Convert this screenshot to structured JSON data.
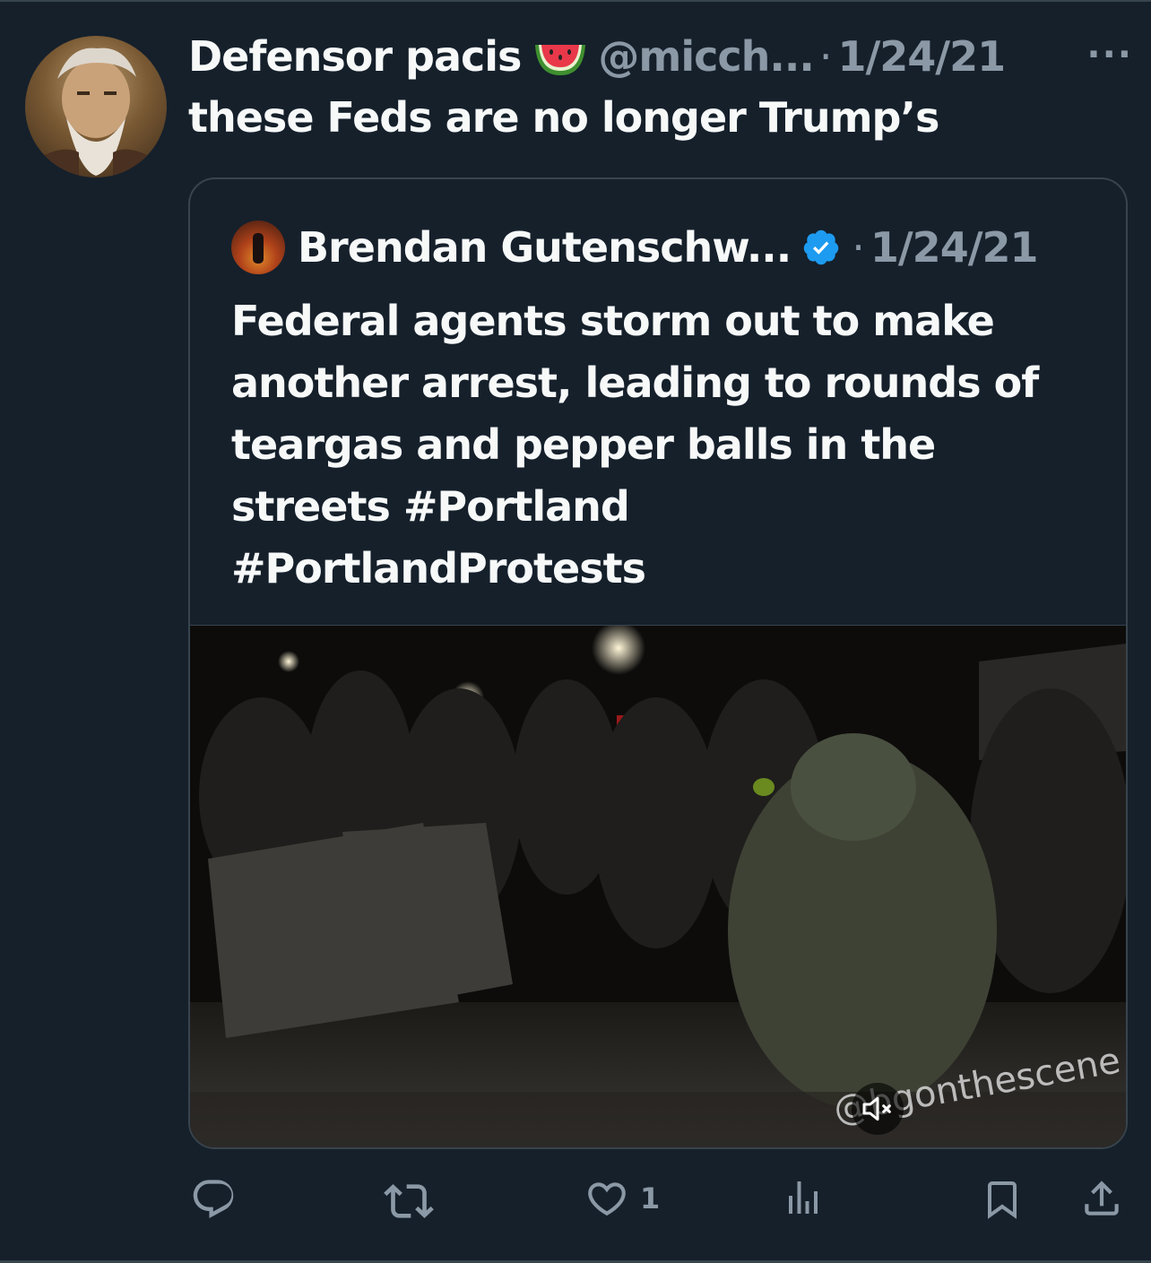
{
  "tweet": {
    "author_name": "Defensor pacis",
    "author_emoji": "watermelon-emoji",
    "handle": "@micch...",
    "separator": "·",
    "date": "1/24/21",
    "more": "···",
    "text": "these Feds are no longer Trump’s"
  },
  "quote": {
    "author_name": "Brendan Gutenschw...",
    "separator": "·",
    "date": "1/24/21",
    "text_lines": [
      "Federal agents storm out to make",
      "another arrest, leading to rounds of",
      "teargas and pepper balls in the",
      "streets #Portland",
      "#PortlandProtests"
    ],
    "video": {
      "watermark": "@bgonthescene",
      "muted": true
    }
  },
  "actions": {
    "reply_count": "",
    "retweet_count": "",
    "like_count": "1",
    "views_count": ""
  },
  "colors": {
    "background": "#15202b",
    "border": "#38444d",
    "secondary_text": "#8b98a5",
    "verified": "#1d9bf0"
  }
}
